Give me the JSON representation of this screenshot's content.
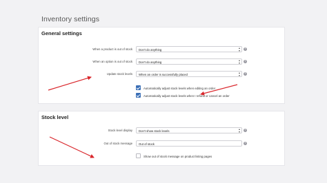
{
  "page": {
    "title": "Inventory settings"
  },
  "general": {
    "title": "General settings",
    "product_out_of_stock": {
      "label": "When a product is out of stock",
      "value": "Don't do anything"
    },
    "option_out_of_stock": {
      "label": "When an option is out of stock",
      "value": "Don't do anything"
    },
    "update_stock_levels": {
      "label": "Update stock levels",
      "value": "When an order is successfully placed"
    },
    "auto_adjust_editing": {
      "label": "Automatically adjust stock levels when editing an order",
      "checked": true
    },
    "auto_adjust_refund": {
      "label": "Automatically adjust stock levels when I refund or cancel an order",
      "checked": true
    }
  },
  "stock": {
    "title": "Stock level",
    "display": {
      "label": "Stock level display",
      "value": "Don't show stock levels"
    },
    "out_of_stock_message": {
      "label": "Out of stock message",
      "value": "Out of stock"
    },
    "show_message_listing": {
      "label": "Show out of stock message on product listing pages",
      "checked": false
    }
  },
  "colors": {
    "accent": "#3b6fb6",
    "annotation_arrow": "#d9262b"
  }
}
